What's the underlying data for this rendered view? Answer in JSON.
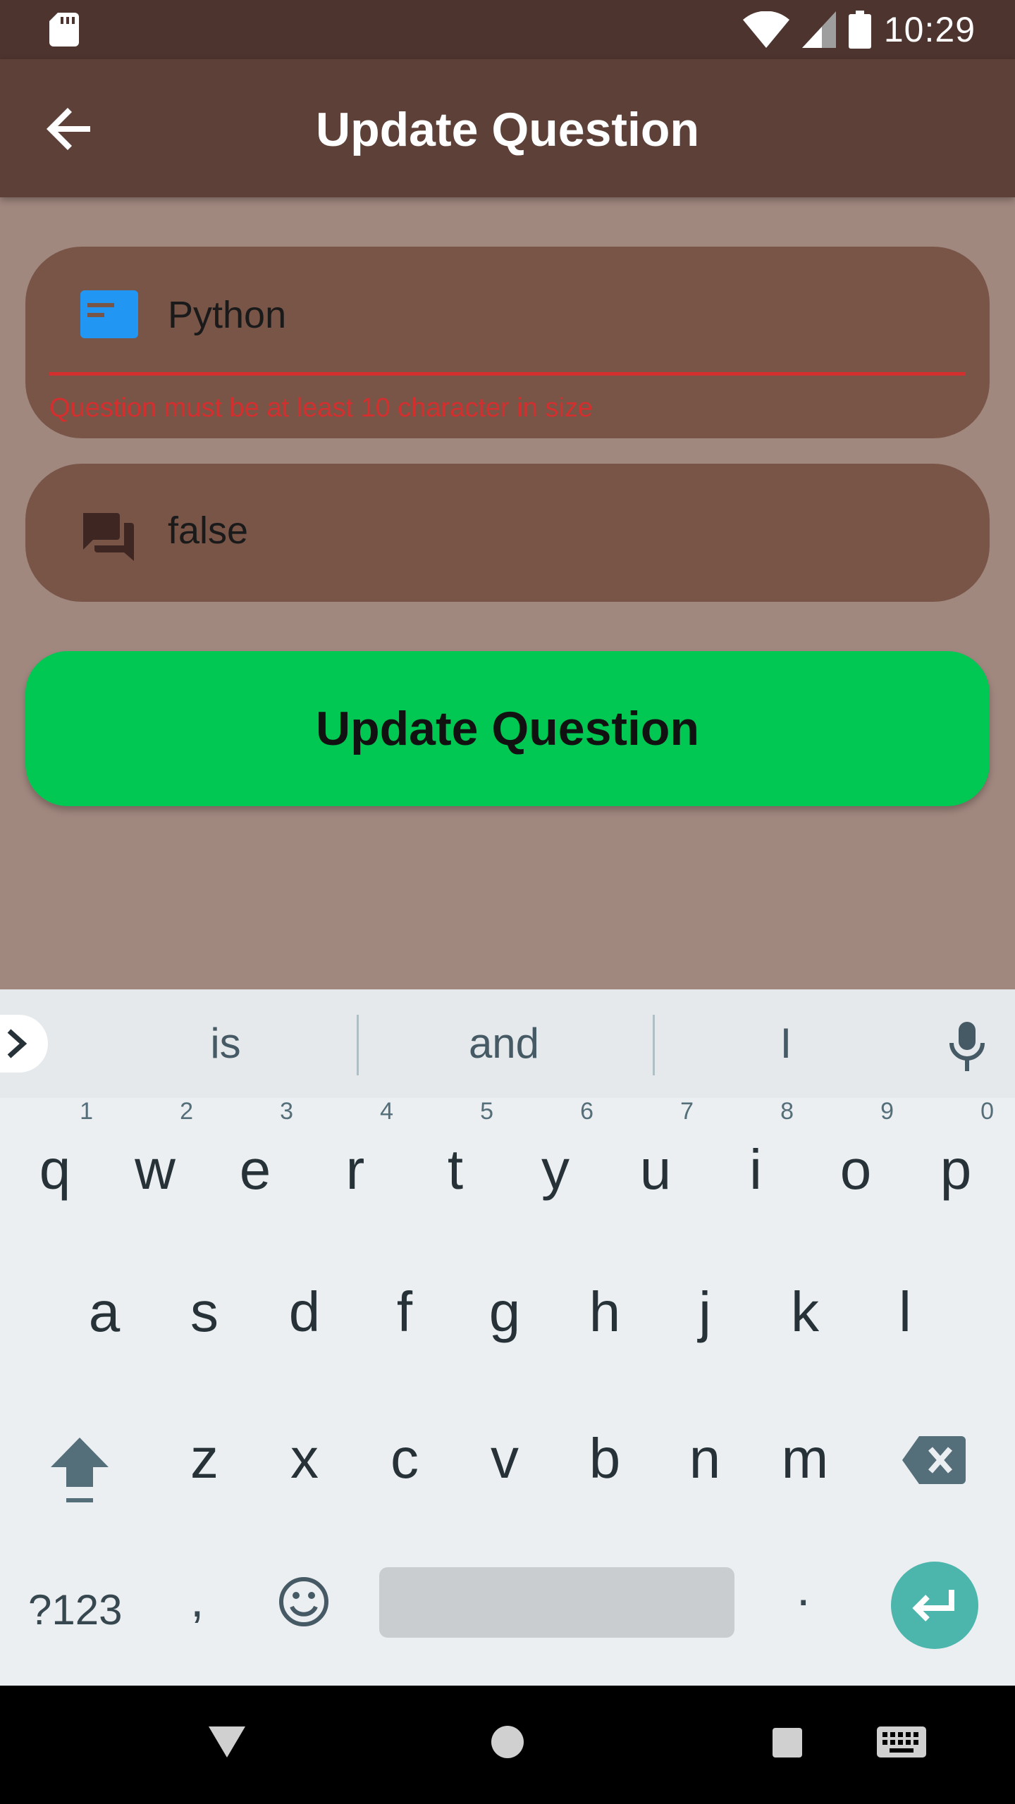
{
  "status_bar": {
    "time": "10:29"
  },
  "app_bar": {
    "title": "Update Question"
  },
  "form": {
    "question_field": {
      "value": "Python",
      "error": "Question must be at least 10 character in size"
    },
    "answer_field": {
      "value": "false"
    },
    "submit_label": "Update Question"
  },
  "keyboard": {
    "suggestions": [
      "is",
      "and",
      "I"
    ],
    "row1": [
      {
        "key": "q",
        "hint": "1"
      },
      {
        "key": "w",
        "hint": "2"
      },
      {
        "key": "e",
        "hint": "3"
      },
      {
        "key": "r",
        "hint": "4"
      },
      {
        "key": "t",
        "hint": "5"
      },
      {
        "key": "y",
        "hint": "6"
      },
      {
        "key": "u",
        "hint": "7"
      },
      {
        "key": "i",
        "hint": "8"
      },
      {
        "key": "o",
        "hint": "9"
      },
      {
        "key": "p",
        "hint": "0"
      }
    ],
    "row2": [
      "a",
      "s",
      "d",
      "f",
      "g",
      "h",
      "j",
      "k",
      "l"
    ],
    "row3": [
      "z",
      "x",
      "c",
      "v",
      "b",
      "n",
      "m"
    ],
    "symbols_label": "?123",
    "comma_label": ",",
    "period_label": "."
  },
  "colors": {
    "status_bar": "#4e342e",
    "app_bar": "#5d4037",
    "background": "#a1887f",
    "field": "#795548",
    "error": "#d32f2f",
    "button": "#00c853",
    "enter_key": "#4db6ac"
  },
  "icons": {
    "sd_card": "sd-card-icon",
    "wifi": "wifi-icon",
    "signal": "signal-icon",
    "battery": "battery-icon",
    "back": "arrow-back-icon",
    "question": "subtitles-icon",
    "answer": "forum-icon",
    "mic": "mic-icon",
    "shift": "shift-icon",
    "backspace": "backspace-icon",
    "emoji": "emoji-icon",
    "enter": "enter-icon",
    "nav_back": "nav-back-icon",
    "nav_home": "nav-home-icon",
    "nav_recents": "nav-recents-icon",
    "keyboard_switch": "keyboard-icon"
  }
}
